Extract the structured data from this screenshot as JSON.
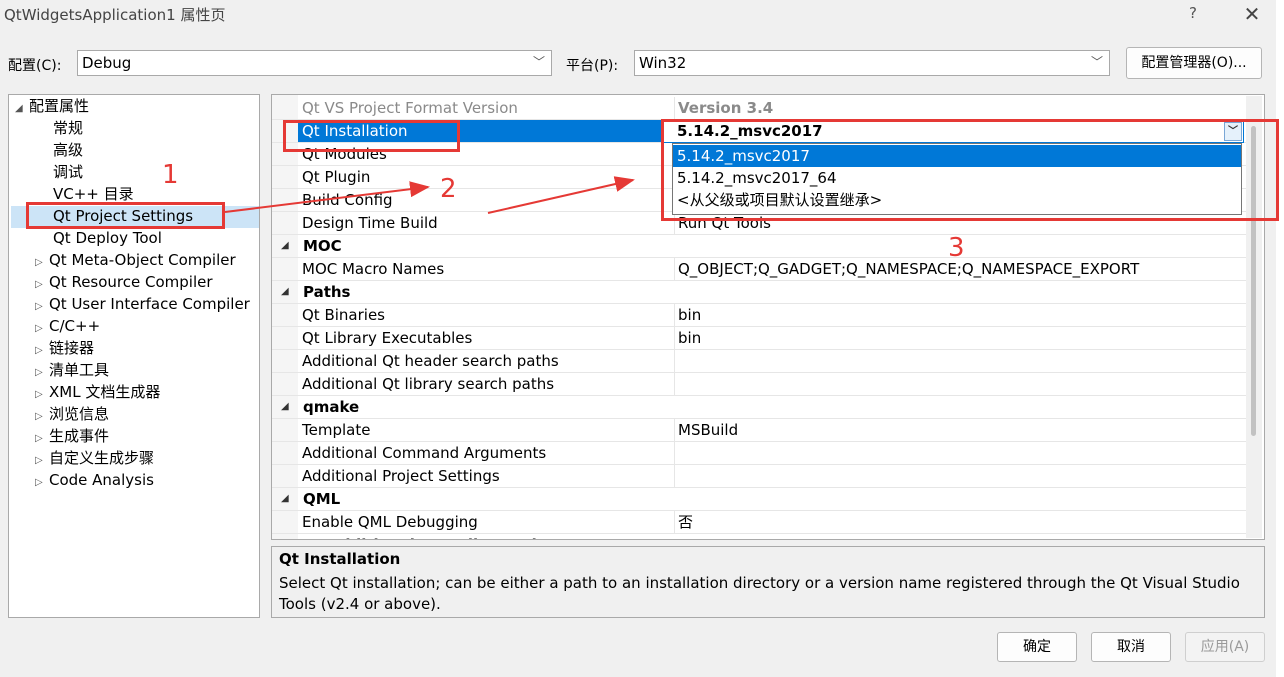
{
  "window": {
    "title": "QtWidgetsApplication1 属性页",
    "help": "?",
    "close": "✕"
  },
  "config": {
    "label": "配置(C):",
    "value": "Debug"
  },
  "platform": {
    "label": "平台(P):",
    "value": "Win32"
  },
  "config_manager": "配置管理器(O)...",
  "tree": {
    "root": "配置属性",
    "items": [
      {
        "label": "常规",
        "expandable": false
      },
      {
        "label": "高级",
        "expandable": false
      },
      {
        "label": "调试",
        "expandable": false
      },
      {
        "label": "VC++ 目录",
        "expandable": false
      },
      {
        "label": "Qt Project Settings",
        "expandable": false,
        "selected": true
      },
      {
        "label": "Qt Deploy Tool",
        "expandable": false
      },
      {
        "label": "Qt Meta-Object Compiler",
        "expandable": true
      },
      {
        "label": "Qt Resource Compiler",
        "expandable": true
      },
      {
        "label": "Qt User Interface Compiler",
        "expandable": true
      },
      {
        "label": "C/C++",
        "expandable": true
      },
      {
        "label": "链接器",
        "expandable": true
      },
      {
        "label": "清单工具",
        "expandable": true
      },
      {
        "label": "XML 文档生成器",
        "expandable": true
      },
      {
        "label": "浏览信息",
        "expandable": true
      },
      {
        "label": "生成事件",
        "expandable": true
      },
      {
        "label": "自定义生成步骤",
        "expandable": true
      },
      {
        "label": "Code Analysis",
        "expandable": true
      }
    ]
  },
  "grid": {
    "rows": [
      {
        "name": "Qt VS Project Format Version",
        "value": "Version 3.4",
        "kind": "gray"
      },
      {
        "name": "Qt Installation",
        "value": "5.14.2_msvc2017",
        "kind": "selected"
      },
      {
        "name": "Qt Modules",
        "value": "",
        "kind": "prop"
      },
      {
        "name": "Qt Plugin",
        "value": "",
        "kind": "prop"
      },
      {
        "name": "Build Config",
        "value": "",
        "kind": "prop"
      },
      {
        "name": "Design Time Build",
        "value": "Run Qt Tools",
        "kind": "prop"
      },
      {
        "name": "MOC",
        "value": "",
        "kind": "category"
      },
      {
        "name": "MOC Macro Names",
        "value": "Q_OBJECT;Q_GADGET;Q_NAMESPACE;Q_NAMESPACE_EXPORT",
        "kind": "prop"
      },
      {
        "name": "Paths",
        "value": "",
        "kind": "category"
      },
      {
        "name": "Qt Binaries",
        "value": "bin",
        "kind": "prop"
      },
      {
        "name": "Qt Library Executables",
        "value": "bin",
        "kind": "prop"
      },
      {
        "name": "Additional Qt header search paths",
        "value": "",
        "kind": "prop"
      },
      {
        "name": "Additional Qt library search paths",
        "value": "",
        "kind": "prop"
      },
      {
        "name": "qmake",
        "value": "",
        "kind": "category"
      },
      {
        "name": "Template",
        "value": "MSBuild",
        "kind": "prop"
      },
      {
        "name": "Additional Command Arguments",
        "value": "",
        "kind": "prop"
      },
      {
        "name": "Additional Project Settings",
        "value": "",
        "kind": "prop"
      },
      {
        "name": "QML",
        "value": "",
        "kind": "category"
      },
      {
        "name": "Enable QML Debugging",
        "value": "否",
        "kind": "prop"
      },
      {
        "name": "Qt Additional Compiler Options",
        "value": "",
        "kind": "category"
      }
    ]
  },
  "dropdown": {
    "value": "5.14.2_msvc2017",
    "options": [
      {
        "label": "5.14.2_msvc2017",
        "selected": true
      },
      {
        "label": "5.14.2_msvc2017_64",
        "selected": false
      },
      {
        "label": "<从父级或项目默认设置继承>",
        "selected": false
      }
    ]
  },
  "description": {
    "title": "Qt Installation",
    "body": "Select Qt installation; can be either a path to an installation directory or a version name registered through the Qt Visual Studio Tools (v2.4 or above)."
  },
  "buttons": {
    "ok": "确定",
    "cancel": "取消",
    "apply": "应用(A)"
  },
  "annotations": {
    "n1": "1",
    "n2": "2",
    "n3": "3"
  },
  "colors": {
    "selection": "#0078d7",
    "annotation": "#e53935",
    "tree_selection": "#cce4f7"
  }
}
